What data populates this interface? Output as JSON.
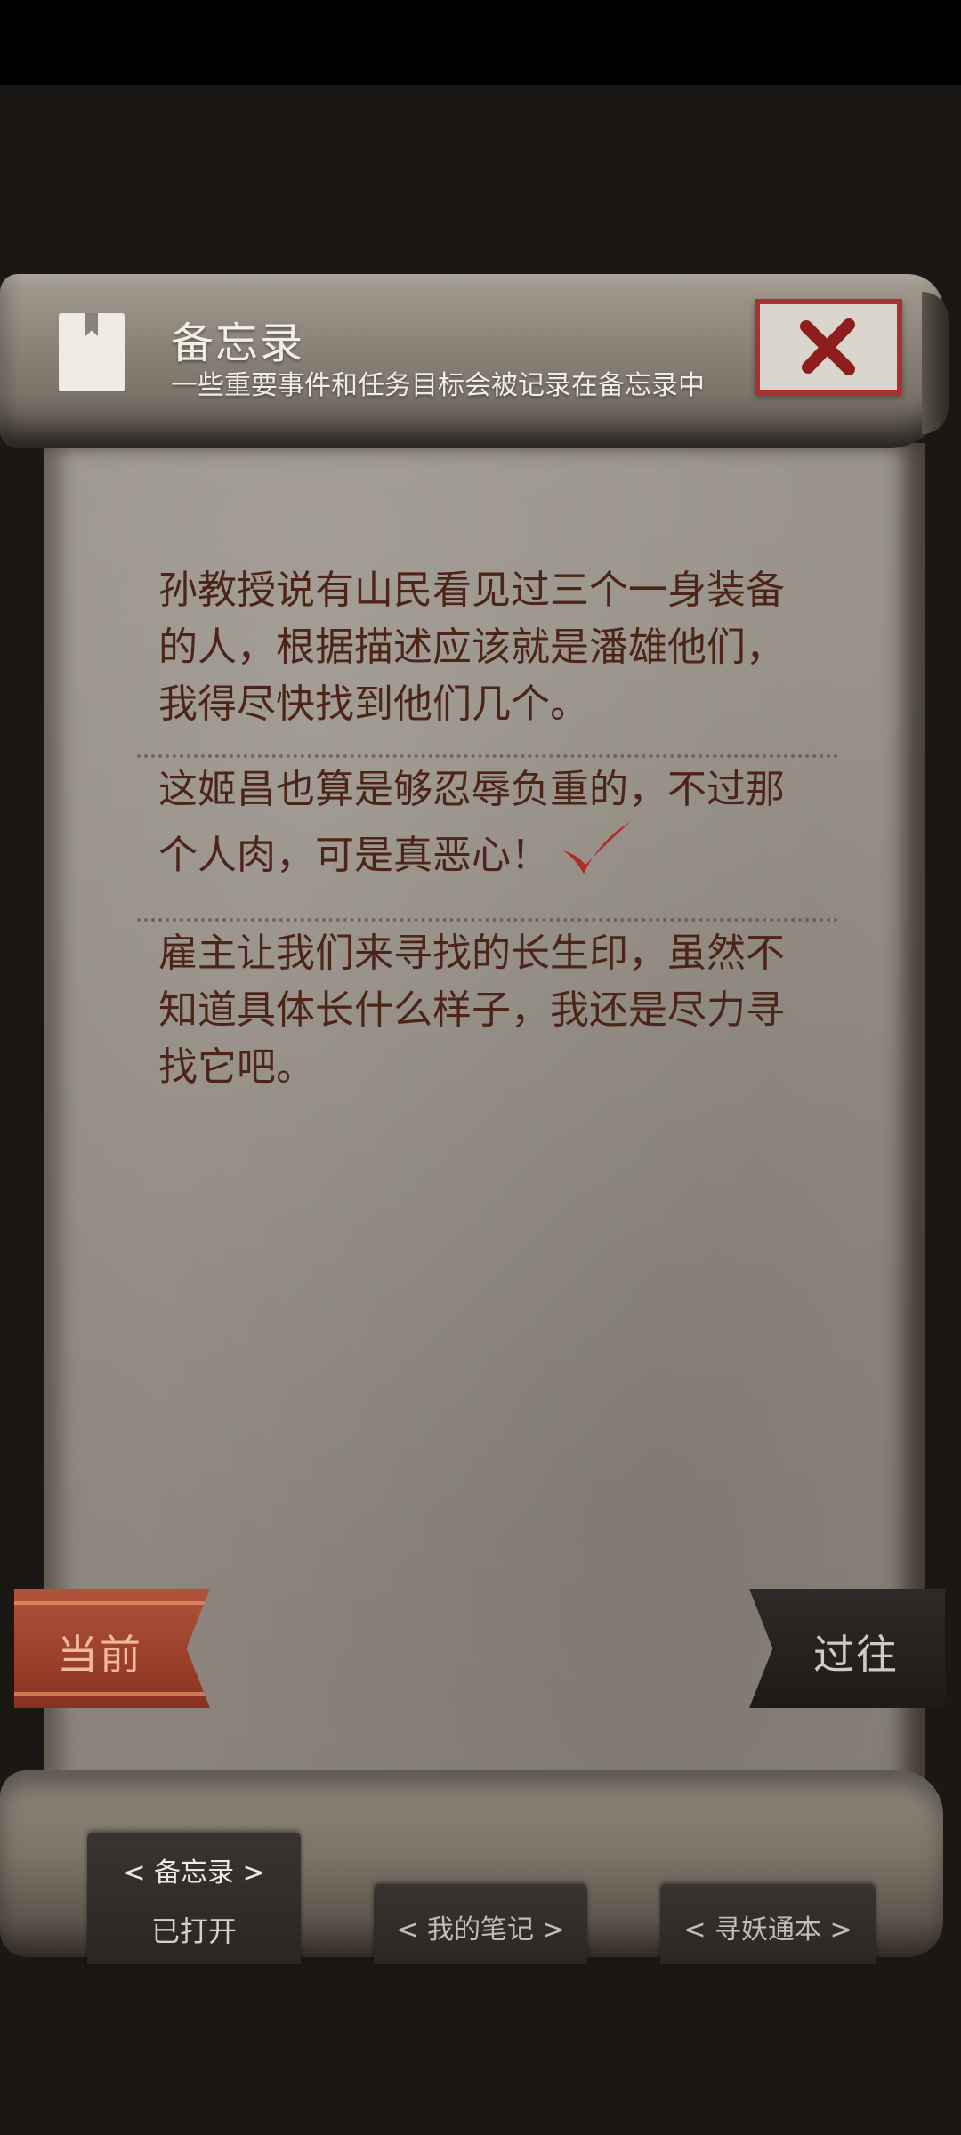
{
  "header": {
    "title": "备忘录",
    "subtitle": "一些重要事件和任务目标会被记录在备忘录中",
    "close_icon": "close-x-icon"
  },
  "notes": [
    {
      "text": "孙教授说有山民看见过三个一身装备的人，根据描述应该就是潘雄他们，我得尽快找到他们几个。",
      "completed": false
    },
    {
      "text": "这姬昌也算是够忍辱负重的，不过那个人肉，可是真恶心！",
      "completed": true
    },
    {
      "text": "雇主让我们来寻找的长生印，虽然不知道具体长什么样子，我还是尽力寻找它吧。",
      "completed": false
    }
  ],
  "ribbons": {
    "current": "当前",
    "past": "过往"
  },
  "tabs": {
    "memo_label": "< 备忘录 >",
    "memo_status": "已打开",
    "notes_label": "< 我的笔记 >",
    "book_label": "< 寻妖通本 >"
  },
  "colors": {
    "accent_red": "#a83232",
    "note_text": "#4d2418",
    "check": "#b02a2a"
  }
}
